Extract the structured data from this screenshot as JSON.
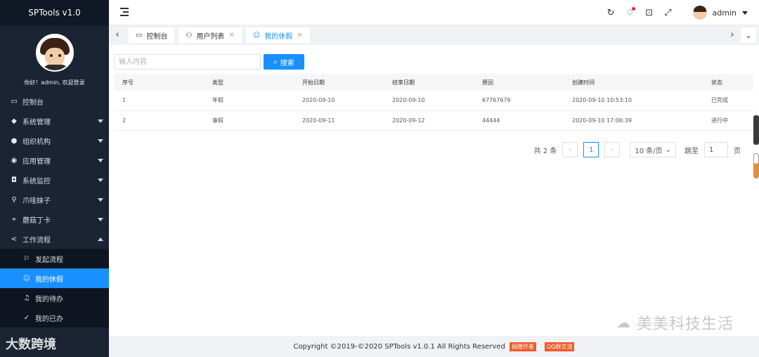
{
  "app": {
    "title": "SPTools v1.0"
  },
  "sidebar": {
    "greeting": "你好！admin, 欢迎登录",
    "items": [
      {
        "label": "控制台",
        "icon": "monitor-icon"
      },
      {
        "label": "系统管理",
        "icon": "layers-icon"
      },
      {
        "label": "组织机构",
        "icon": "users-icon"
      },
      {
        "label": "应用管理",
        "icon": "compass-icon"
      },
      {
        "label": "系统监控",
        "icon": "camera-icon"
      },
      {
        "label": "爪哇妹子",
        "icon": "key-icon"
      },
      {
        "label": "蘑菇丁卡",
        "icon": "location-icon"
      },
      {
        "label": "工作流程",
        "icon": "share-icon"
      }
    ],
    "submenu": [
      {
        "label": "发起流程",
        "icon": "flag-icon"
      },
      {
        "label": "我的休假",
        "icon": "smile-icon"
      },
      {
        "label": "我的待办",
        "icon": "bell-icon"
      },
      {
        "label": "我的已办",
        "icon": "check-icon"
      }
    ],
    "watermark": "大数跨境"
  },
  "header": {
    "username": "admin"
  },
  "tabs": [
    {
      "label": "控制台"
    },
    {
      "label": "用户列表"
    },
    {
      "label": "我的休假"
    }
  ],
  "search": {
    "placeholder": "输入内容",
    "button": "搜索"
  },
  "table": {
    "columns": [
      "序号",
      "类型",
      "开始日期",
      "结束日期",
      "原因",
      "创建时间",
      "状态"
    ],
    "rows": [
      [
        "1",
        "年假",
        "2020-09-10",
        "2020-09-10",
        "67767676",
        "2020-09-10 10:53:10",
        "已完成"
      ],
      [
        "2",
        "事假",
        "2020-09-11",
        "2020-09-12",
        "44444",
        "2020-09-10 17:06:39",
        "进行中"
      ]
    ]
  },
  "pager": {
    "total": "共 2 条",
    "current": "1",
    "page_size": "10 条/页",
    "jump_label": "跳至",
    "jump_value": "1",
    "page_suffix": "页"
  },
  "footer": {
    "copyright": "Copyright ©2019-©2020 SPTools v1.0.1 All Rights Reserved",
    "tag1": "捐赠作者",
    "tag2": "QQ群交流"
  },
  "overlay": {
    "wechat": "美美科技生活"
  },
  "colors": {
    "accent": "#1890ff",
    "sidebar_bg": "#1a2433",
    "tag_bg": "#f25a28"
  }
}
